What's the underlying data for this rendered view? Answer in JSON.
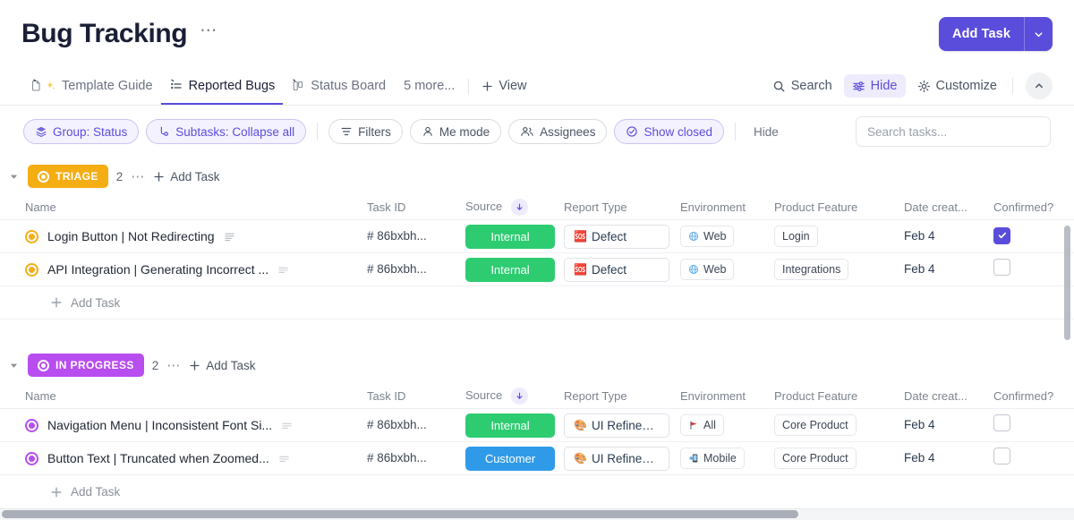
{
  "header": {
    "title": "Bug Tracking",
    "more_dots": "⋯",
    "add_task_label": "Add Task",
    "accent_color": "#5b4ddb"
  },
  "tabs": [
    {
      "label": "Template Guide",
      "icon": "doc-sparkle-icon",
      "active": false
    },
    {
      "label": "Reported Bugs",
      "icon": "list-icon",
      "active": true
    },
    {
      "label": "Status Board",
      "icon": "board-icon",
      "active": false
    }
  ],
  "tabbar": {
    "more_label": "5 more...",
    "add_view_label": "View",
    "tools": [
      {
        "label": "Search",
        "icon": "search-icon",
        "highlight": false
      },
      {
        "label": "Hide",
        "icon": "sliders-icon",
        "highlight": true
      },
      {
        "label": "Customize",
        "icon": "gear-icon",
        "highlight": false
      }
    ]
  },
  "filterbar": {
    "pills": [
      {
        "label": "Group: Status",
        "icon": "layers-icon",
        "selected": true
      },
      {
        "label": "Subtasks: Collapse all",
        "icon": "subtask-icon",
        "selected": true
      },
      {
        "label": "Filters",
        "icon": "filter-icon",
        "selected": false
      },
      {
        "label": "Me mode",
        "icon": "person-icon",
        "selected": false
      },
      {
        "label": "Assignees",
        "icon": "people-icon",
        "selected": false
      },
      {
        "label": "Show closed",
        "icon": "check-circle-icon",
        "selected": true
      }
    ],
    "hide_label": "Hide",
    "search_placeholder": "Search tasks...",
    "search_value": ""
  },
  "columns": [
    "Name",
    "Task ID",
    "Source",
    "Report Type",
    "Environment",
    "Product Feature",
    "Date creat...",
    "Confirmed?"
  ],
  "groups": [
    {
      "status": "TRIAGE",
      "color": "#f5ad14",
      "count": "2",
      "dots": "⋯",
      "add_task_label": "Add Task",
      "footer_add_label": "Add Task",
      "rows": [
        {
          "name": "Login Button | Not Redirecting",
          "task_id": "# 86bxbh...",
          "source": "Internal",
          "source_color": "#2ecc71",
          "report_type": "Defect",
          "report_emoji": "🆘",
          "environment": "Web",
          "env_icon": "globe-icon",
          "feature": "Login",
          "date": "Feb 4",
          "confirmed": true
        },
        {
          "name": "API Integration | Generating Incorrect ...",
          "task_id": "# 86bxbh...",
          "source": "Internal",
          "source_color": "#2ecc71",
          "report_type": "Defect",
          "report_emoji": "🆘",
          "environment": "Web",
          "env_icon": "globe-icon",
          "feature": "Integrations",
          "date": "Feb 4",
          "confirmed": false
        }
      ]
    },
    {
      "status": "IN PROGRESS",
      "color": "#b84df0",
      "count": "2",
      "dots": "⋯",
      "add_task_label": "Add Task",
      "footer_add_label": "Add Task",
      "rows": [
        {
          "name": "Navigation Menu | Inconsistent Font Si...",
          "task_id": "# 86bxbh...",
          "source": "Internal",
          "source_color": "#2ecc71",
          "report_type": "UI Refinem...",
          "report_emoji": "🎨",
          "environment": "All",
          "env_icon": "flag-icon",
          "feature": "Core Product",
          "date": "Feb 4",
          "confirmed": false
        },
        {
          "name": "Button Text | Truncated when Zoomed...",
          "task_id": "# 86bxbh...",
          "source": "Customer",
          "source_color": "#2f9be8",
          "report_type": "UI Refinem...",
          "report_emoji": "🎨",
          "environment": "Mobile",
          "env_icon": "mobile-icon",
          "feature": "Core Product",
          "date": "Feb 4",
          "confirmed": false
        }
      ]
    }
  ]
}
